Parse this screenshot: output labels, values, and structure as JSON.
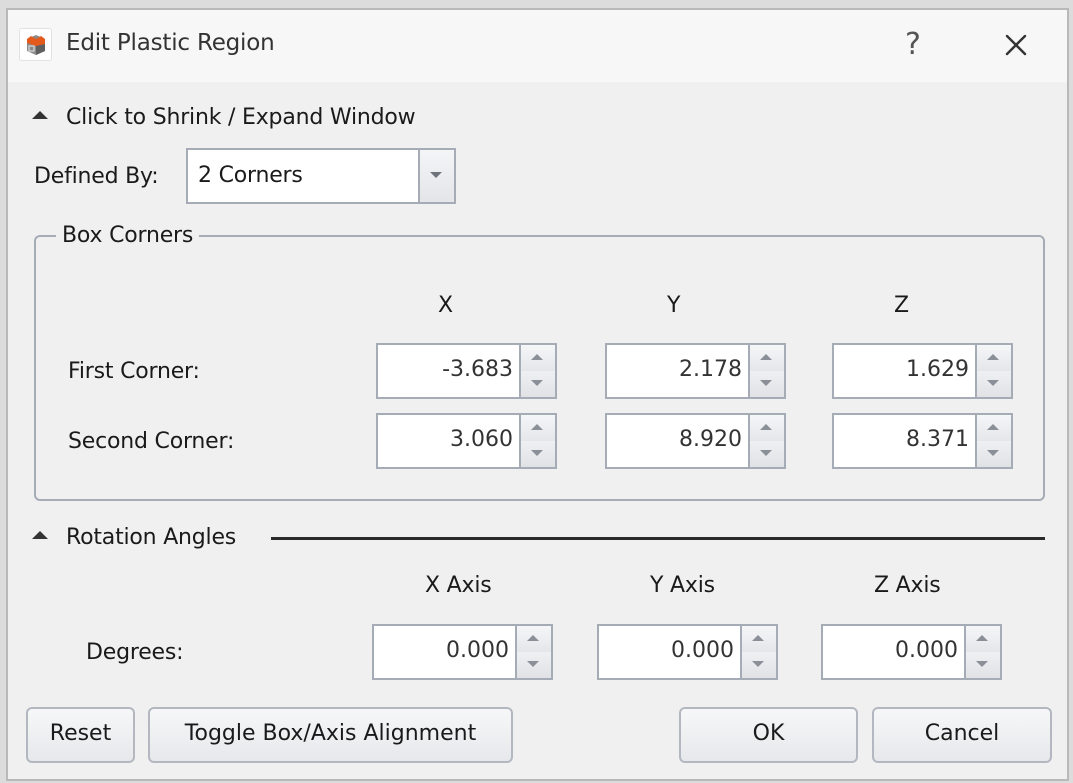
{
  "window": {
    "title": "Edit Plastic Region",
    "app_icon": "plastic-region-box-icon",
    "help_label": "?",
    "close_icon": "close-icon",
    "accent_color": "#e35a1c"
  },
  "shrink_expand": {
    "label": "Click to Shrink / Expand Window",
    "icon": "collapse-triangle-up-icon"
  },
  "defined_by": {
    "label": "Defined By:",
    "value": "2 Corners"
  },
  "box_corners": {
    "title": "Box Corners",
    "columns": [
      "X",
      "Y",
      "Z"
    ],
    "rows": [
      {
        "label": "First Corner:",
        "values": [
          "-3.683",
          "2.178",
          "1.629"
        ]
      },
      {
        "label": "Second Corner:",
        "values": [
          "3.060",
          "8.920",
          "8.371"
        ]
      }
    ]
  },
  "rotation_angles": {
    "title": "Rotation Angles",
    "columns": [
      "X Axis",
      "Y Axis",
      "Z Axis"
    ],
    "row": {
      "label": "Degrees:",
      "values": [
        "0.000",
        "0.000",
        "0.000"
      ]
    }
  },
  "buttons": {
    "reset": "Reset",
    "toggle": "Toggle Box/Axis Alignment",
    "ok": "OK",
    "cancel": "Cancel"
  }
}
